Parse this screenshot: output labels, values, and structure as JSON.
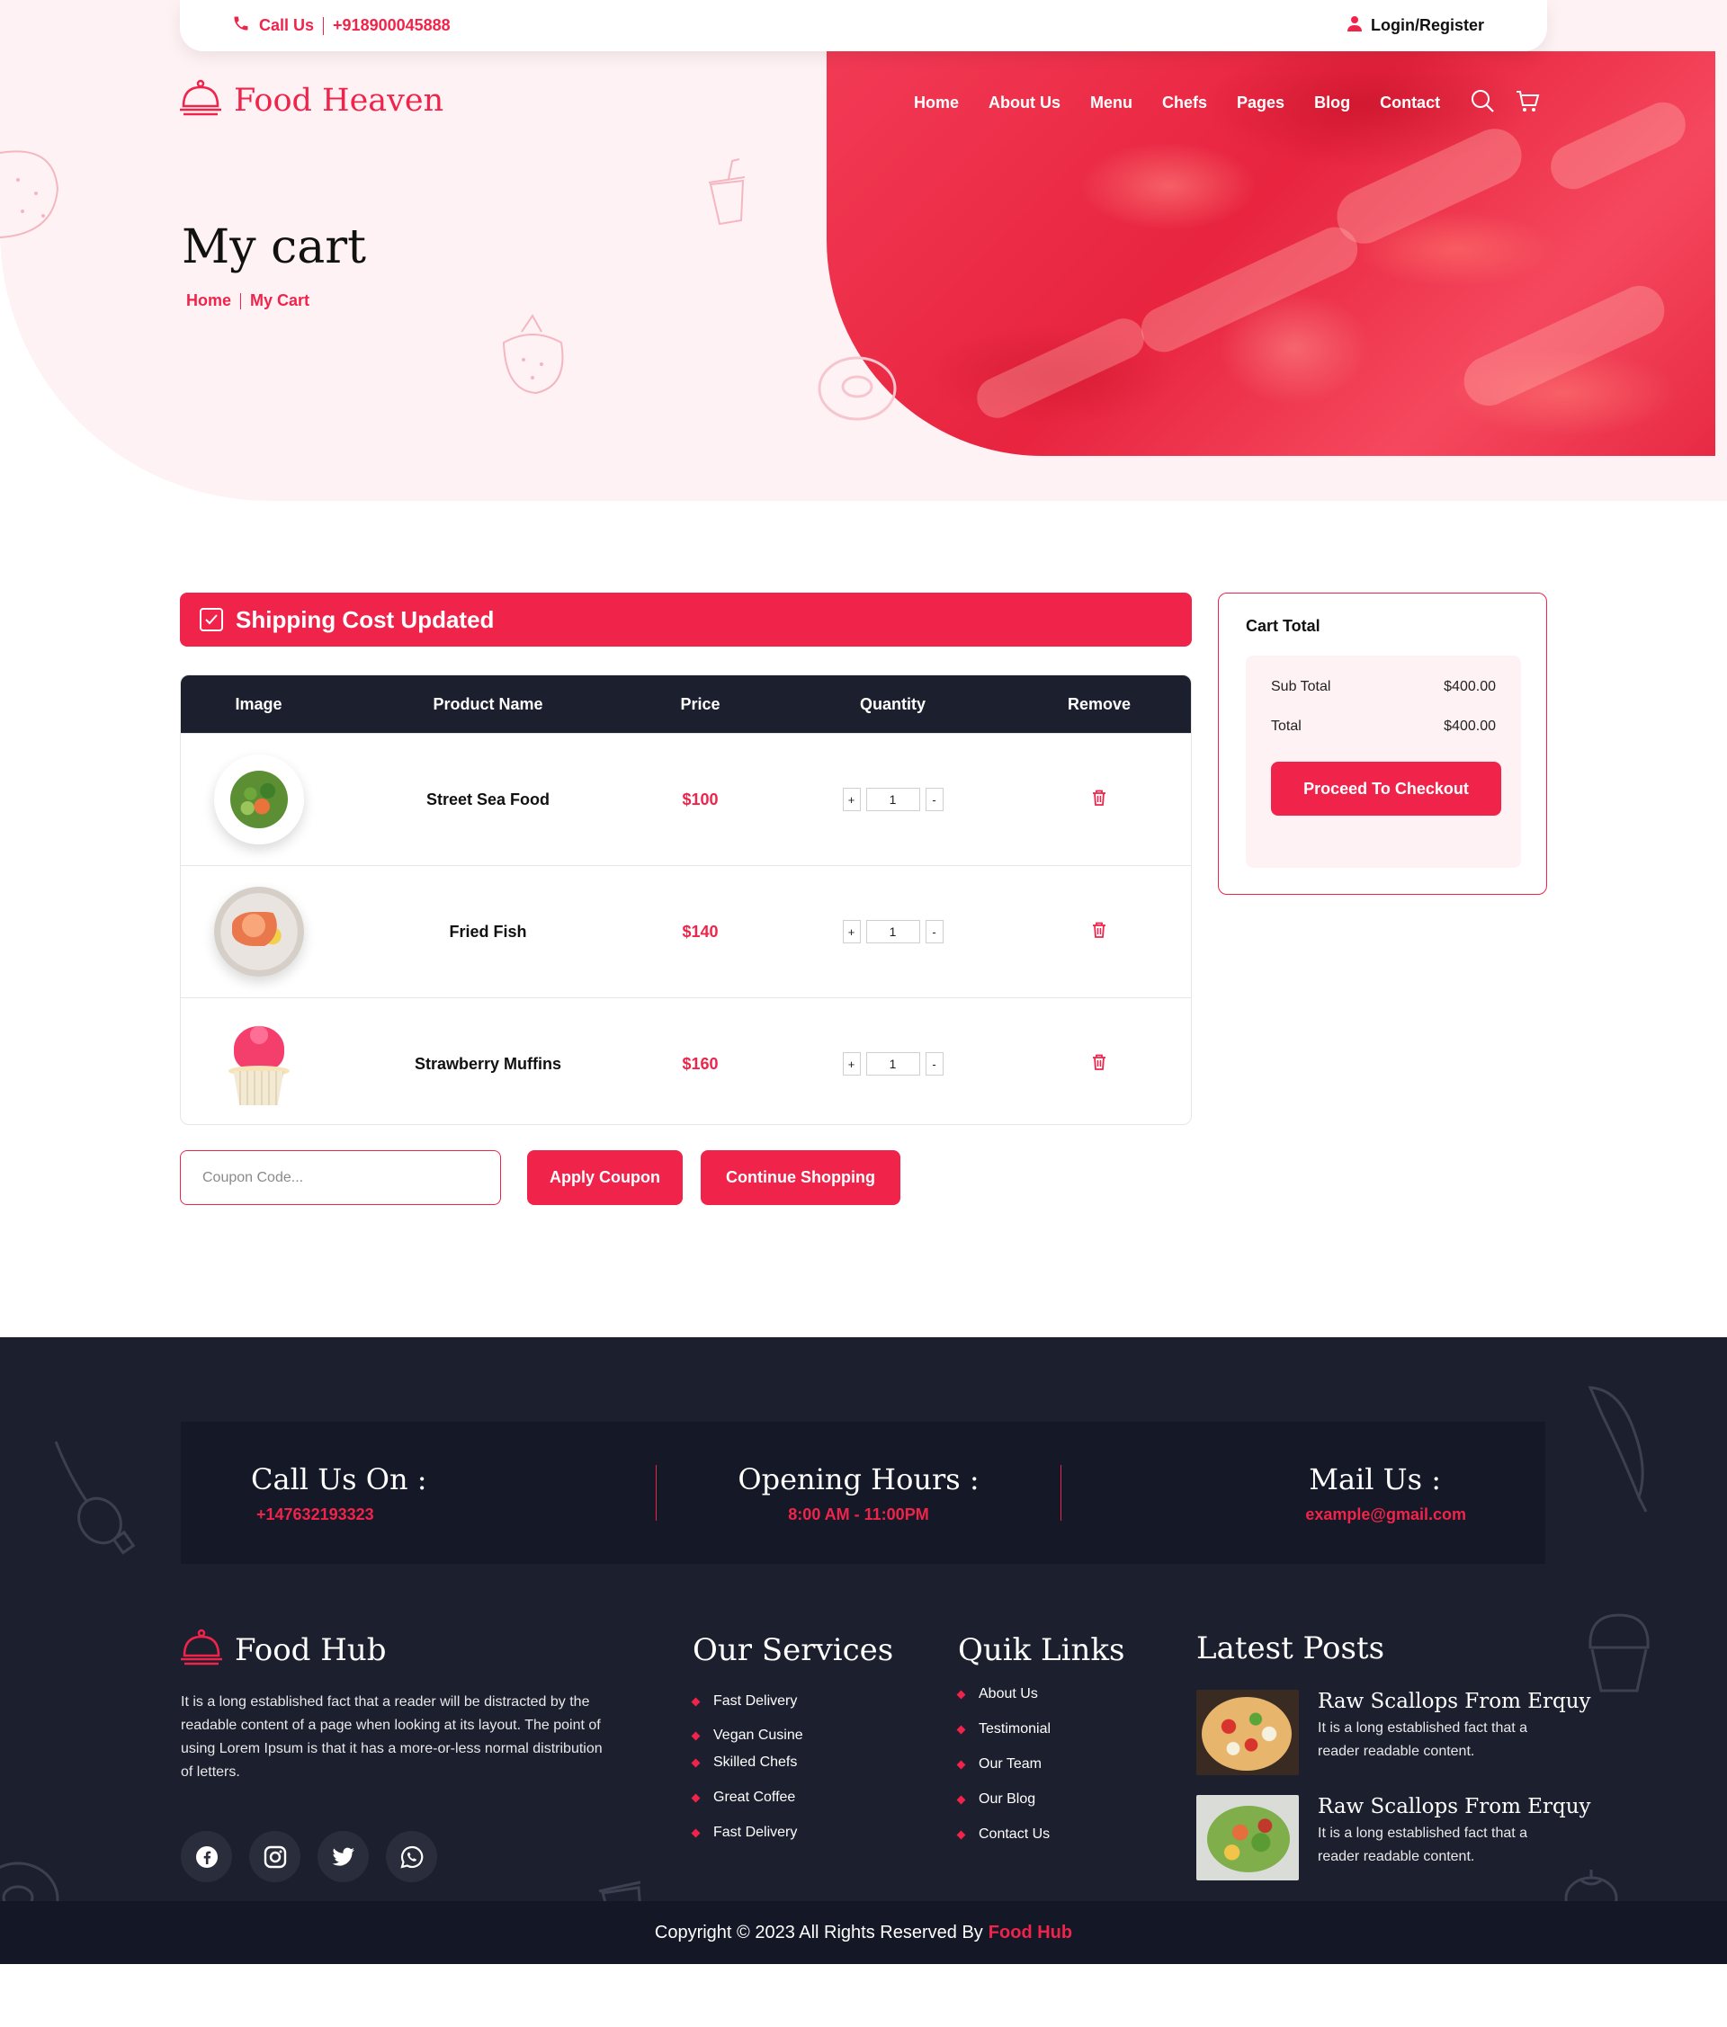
{
  "topbar": {
    "call_label": "Call Us",
    "phone": "+918900045888",
    "login_label": "Login/Register"
  },
  "brand": {
    "name": "Food Heaven"
  },
  "nav": {
    "items": [
      "Home",
      "About Us",
      "Menu",
      "Chefs",
      "Pages",
      "Blog",
      "Contact"
    ],
    "search_icon": "search-icon",
    "cart_icon": "cart-icon"
  },
  "hero": {
    "title": "My cart",
    "breadcrumb": [
      "Home",
      "My Cart"
    ]
  },
  "alert": {
    "text": "Shipping Cost Updated"
  },
  "table": {
    "headers": [
      "Image",
      "Product Name",
      "Price",
      "Quantity",
      "Remove"
    ],
    "rows": [
      {
        "name": "Street Sea Food",
        "price": "$100",
        "qty": "1"
      },
      {
        "name": "Fried Fish",
        "price": "$140",
        "qty": "1"
      },
      {
        "name": "Strawberry Muffins",
        "price": "$160",
        "qty": "1"
      }
    ],
    "plus": "+",
    "minus": "-"
  },
  "coupon": {
    "placeholder": "Coupon Code...",
    "apply_label": "Apply Coupon",
    "continue_label": "Continue Shopping"
  },
  "cart_total": {
    "title": "Cart Total",
    "subtotal_label": "Sub Total",
    "subtotal_value": "$400.00",
    "total_label": "Total",
    "total_value": "$400.00",
    "checkout_label": "Proceed To Checkout"
  },
  "footer": {
    "info": [
      {
        "heading": "Call Us On :",
        "value": "+147632193323"
      },
      {
        "heading": "Opening Hours :",
        "value": "8:00 AM - 11:00PM"
      },
      {
        "heading": "Mail Us :",
        "value": "example@gmail.com"
      }
    ],
    "brand": "Food Hub",
    "about": "It is a long established fact that a reader will be distracted by the readable content of a page when looking at its layout. The point of using Lorem Ipsum is that it has a more-or-less normal distribution of letters.",
    "socials": [
      "facebook-icon",
      "instagram-icon",
      "twitter-icon",
      "whatsapp-icon"
    ],
    "services_title": "Our Services",
    "services": [
      "Fast Delivery",
      "Vegan Cusine",
      "Skilled Chefs",
      "Great Coffee",
      "Fast Delivery"
    ],
    "links_title": "Quik Links",
    "links": [
      "About Us",
      "Testimonial",
      "Our Team",
      "Our Blog",
      "Contact Us"
    ],
    "posts_title": "Latest Posts",
    "posts": [
      {
        "title": "Raw Scallops From Erquy",
        "desc": "It is a long established fact that a reader readable content."
      },
      {
        "title": "Raw Scallops From Erquy",
        "desc": "It is a long established fact that a reader readable content."
      }
    ],
    "copyright": "Copyright © 2023 All Rights Reserved By",
    "copyright_brand": "Food Hub"
  },
  "colors": {
    "accent": "#f0244b",
    "dark": "#1c1f2e",
    "hero_bg": "#fff2f4"
  }
}
